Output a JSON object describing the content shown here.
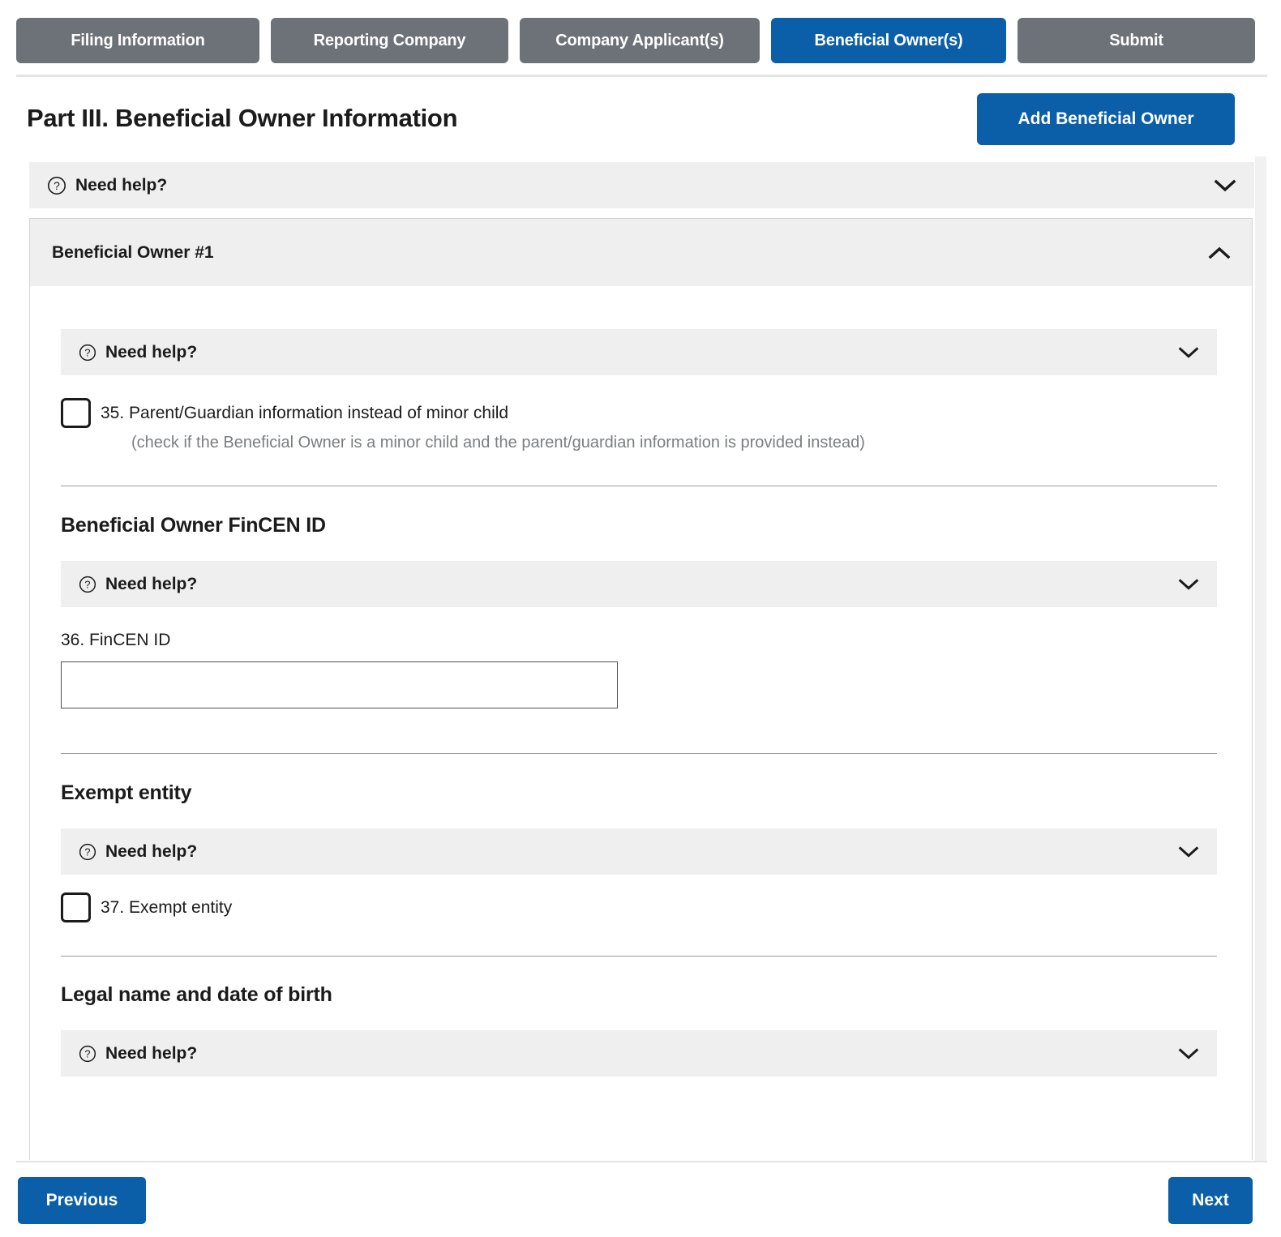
{
  "colors": {
    "accent_blue": "#0b5ea8",
    "tab_gray": "#6d7278",
    "helpbar_bg": "#efefef",
    "muted_text": "#7b7e81",
    "card_border": "#d6d6d6"
  },
  "tabs": [
    {
      "label": "Filing Information",
      "active": false
    },
    {
      "label": "Reporting Company",
      "active": false
    },
    {
      "label": "Company Applicant(s)",
      "active": false
    },
    {
      "label": "Beneficial Owner(s)",
      "active": true
    },
    {
      "label": "Submit",
      "active": false
    }
  ],
  "header": {
    "title": "Part III. Beneficial Owner Information",
    "add_button_label": "Add Beneficial Owner"
  },
  "icons": {
    "help": "question-circle-icon",
    "chevron_down": "chevron-down-icon",
    "chevron_up": "chevron-up-icon"
  },
  "help_label": "Need help?",
  "outer_help": {
    "label": "Need help?",
    "expanded": false
  },
  "beneficial_owner": {
    "card_title": "Beneficial Owner #1",
    "expanded": true,
    "help": {
      "label": "Need help?",
      "expanded": false
    },
    "checkbox_35": {
      "label": "35. Parent/Guardian information instead of minor child",
      "sublabel": "(check if the Beneficial Owner is a minor child and the parent/guardian information is provided instead)",
      "checked": false
    },
    "sections": [
      {
        "heading": "Beneficial Owner FinCEN ID",
        "help": {
          "label": "Need help?",
          "expanded": false
        },
        "field": {
          "label": "36. FinCEN ID",
          "value": "",
          "placeholder": ""
        }
      },
      {
        "heading": "Exempt entity",
        "help": {
          "label": "Need help?",
          "expanded": false
        },
        "checkbox": {
          "label": "37. Exempt entity",
          "checked": false
        }
      },
      {
        "heading": "Legal name and date of birth",
        "help": {
          "label": "Need help?",
          "expanded": false
        }
      }
    ]
  },
  "bottom_nav": {
    "previous_label": "Previous",
    "next_label": "Next"
  }
}
